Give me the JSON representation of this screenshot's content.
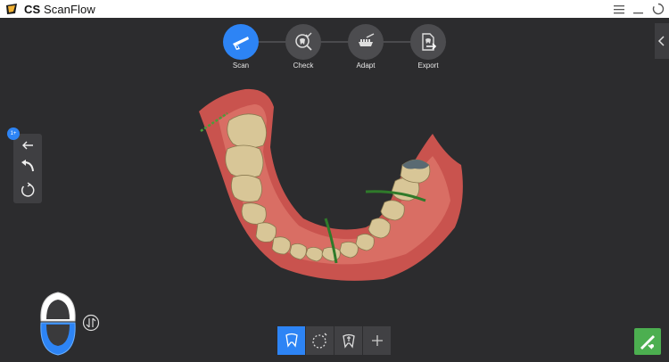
{
  "app": {
    "title_bold": "CS",
    "title_rest": "ScanFlow"
  },
  "window_controls": {
    "icons": [
      "menu-icon",
      "minimize-icon",
      "loading-icon"
    ]
  },
  "workflow": {
    "steps": [
      {
        "label": "Scan",
        "icon": "scanner-icon",
        "active": true
      },
      {
        "label": "Check",
        "icon": "tooth-check-icon",
        "active": false
      },
      {
        "label": "Adapt",
        "icon": "jaw-adapt-icon",
        "active": false
      },
      {
        "label": "Export",
        "icon": "export-file-icon",
        "active": false
      }
    ]
  },
  "left_tools": {
    "badge": "1+",
    "buttons": [
      "back-arrow-icon",
      "undo-icon",
      "reset-view-icon"
    ]
  },
  "bottom_tools": {
    "buttons": [
      "tooth-scan-icon",
      "dotted-select-icon",
      "tooth-trim-icon",
      "add-icon"
    ]
  },
  "colors": {
    "accent": "#2d84f5",
    "background": "#2c2c2e",
    "finish": "#4caf50",
    "gum": "#d9605a",
    "tooth": "#d9c89a"
  }
}
